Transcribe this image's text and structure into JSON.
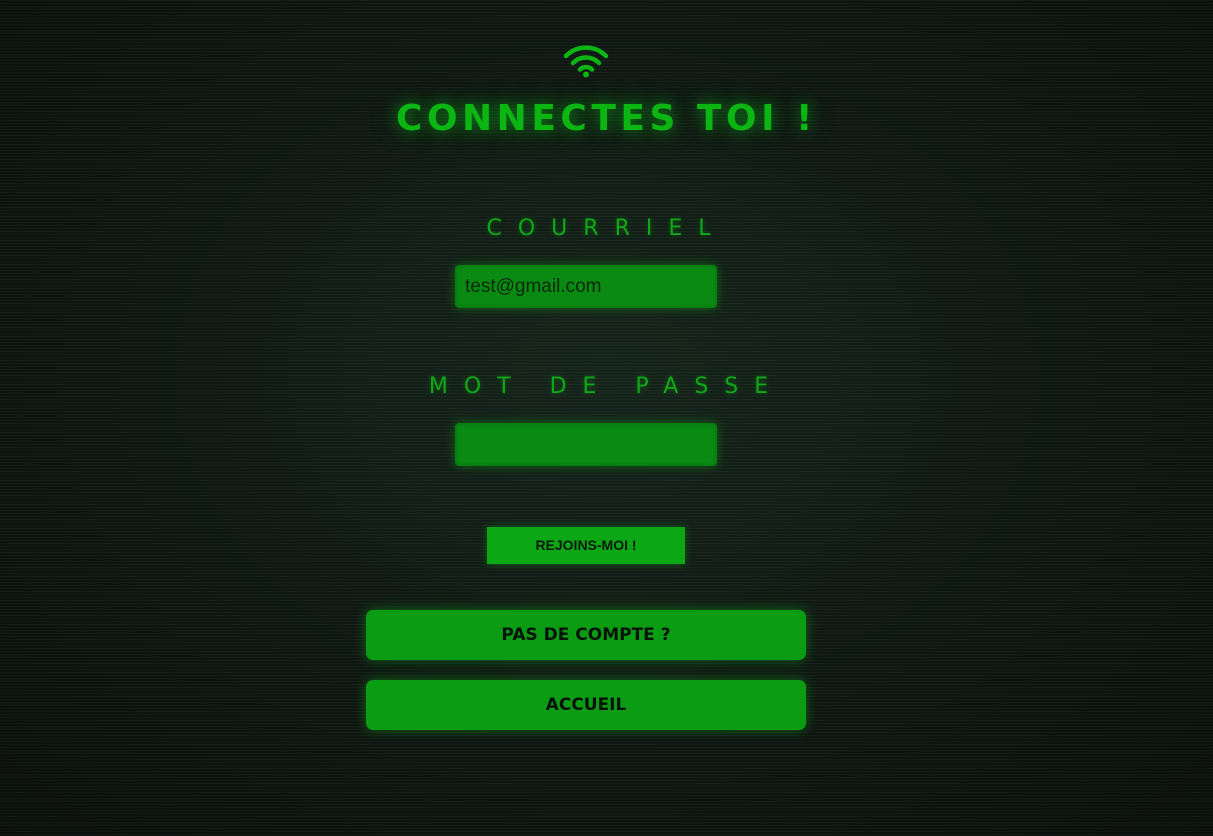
{
  "theme": {
    "accent": "#0bb512",
    "button_bg": "#0a9c12",
    "input_bg": "#0a8a12",
    "background": "#0d1410"
  },
  "header": {
    "icon": "wifi-icon",
    "title": "CONNECTES TOI !"
  },
  "form": {
    "email_label": "COURRIEL",
    "email_value": "test@gmail.com",
    "password_label": "MOT DE PASSE",
    "password_value": "",
    "submit_label": "REJOINS-MOI !"
  },
  "nav": {
    "no_account_label": "PAS DE COMPTE ?",
    "home_label": "ACCUEIL"
  }
}
